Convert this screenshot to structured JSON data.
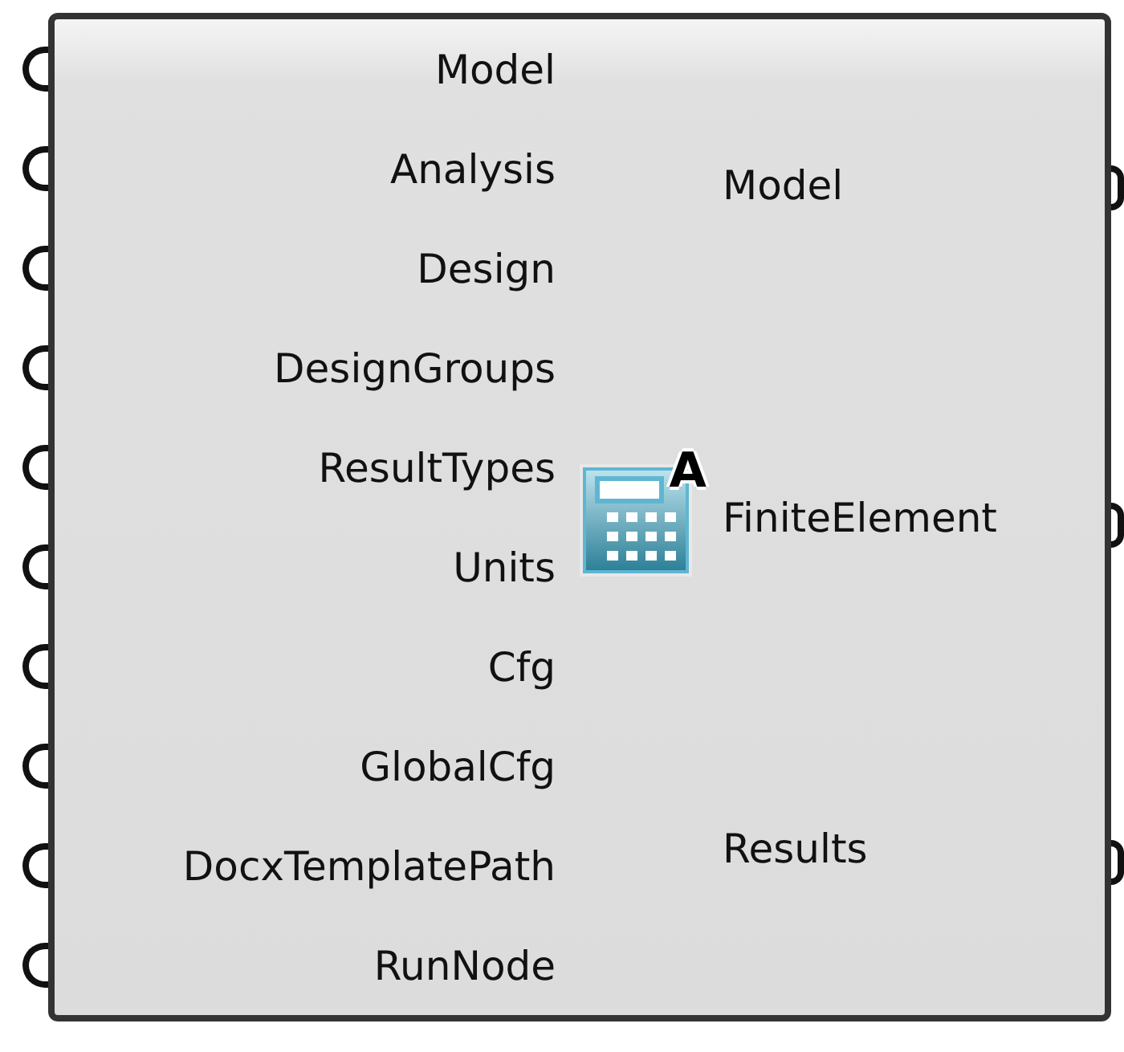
{
  "inputs": [
    {
      "label": "Model"
    },
    {
      "label": "Analysis"
    },
    {
      "label": "Design"
    },
    {
      "label": "DesignGroups"
    },
    {
      "label": "ResultTypes"
    },
    {
      "label": "Units"
    },
    {
      "label": "Cfg"
    },
    {
      "label": "GlobalCfg"
    },
    {
      "label": "DocxTemplatePath"
    },
    {
      "label": "RunNode"
    }
  ],
  "icon_letter": "A",
  "outputs": [
    {
      "label": "Model"
    },
    {
      "label": "FiniteElement"
    },
    {
      "label": "Results"
    }
  ]
}
